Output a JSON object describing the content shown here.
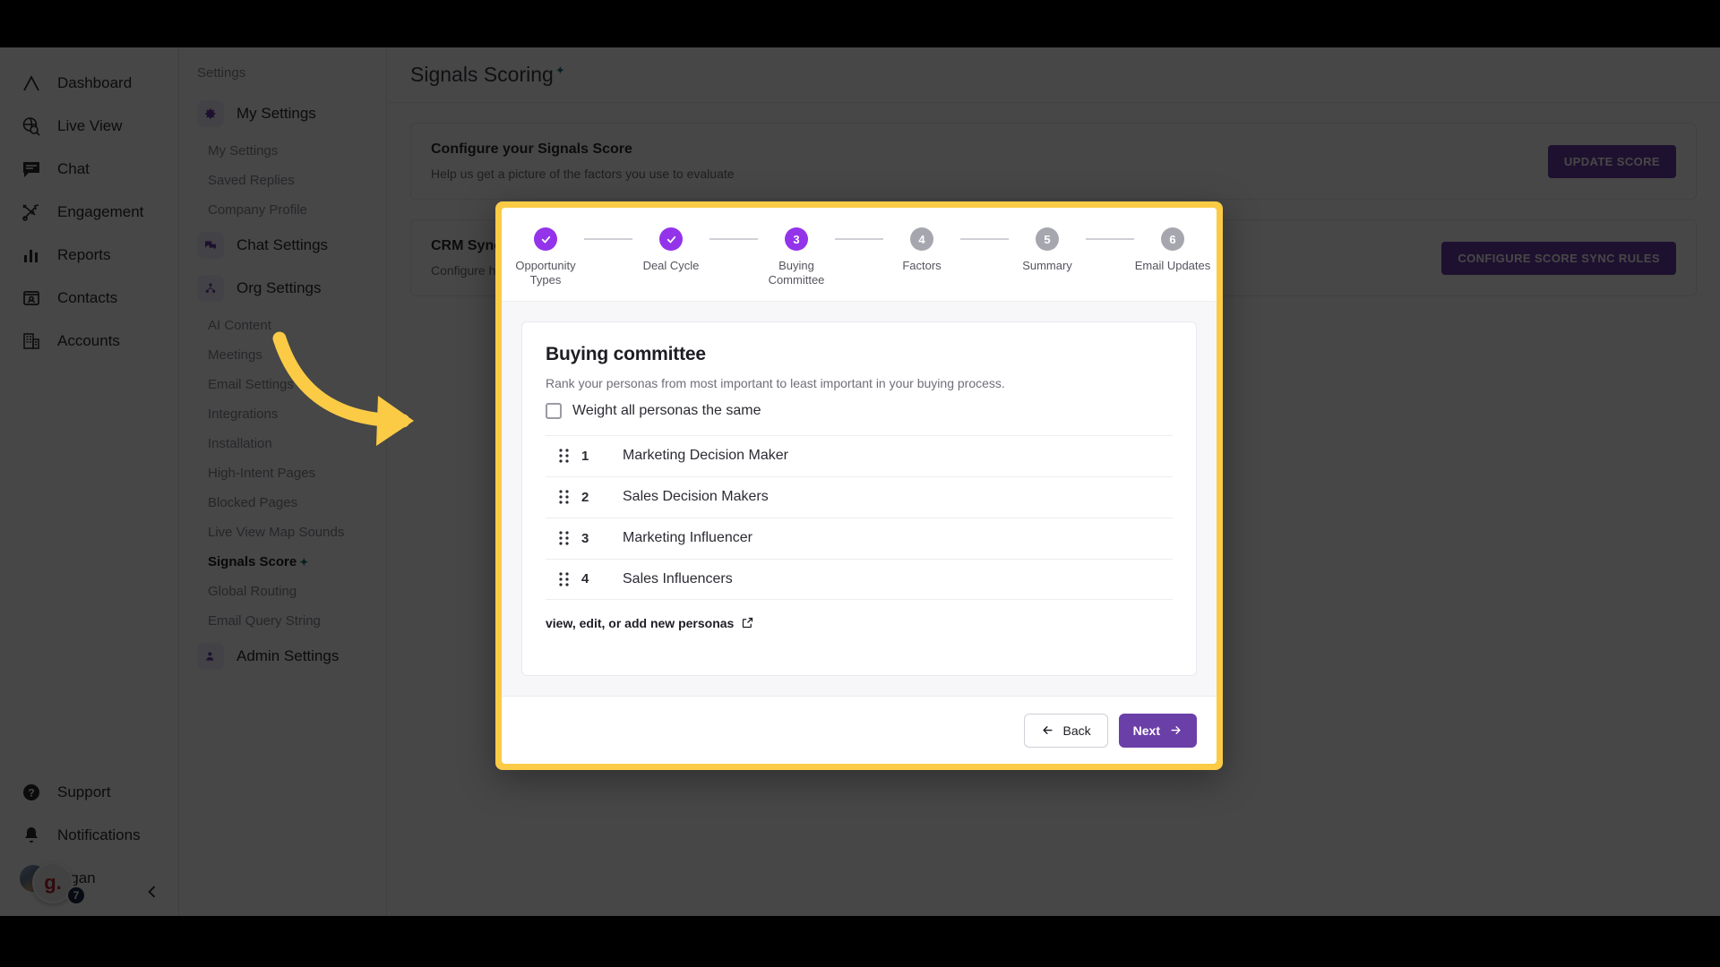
{
  "colors": {
    "highlight_yellow": "#FBCB46",
    "primary_purple": "#6B3FA8",
    "step_active_purple": "#9333EA",
    "step_inactive_gray": "#A6A6AE",
    "sparkle_teal": "#1F6F7A"
  },
  "nav": {
    "items": [
      {
        "label": "Dashboard",
        "icon": "logo-chevron-icon"
      },
      {
        "label": "Live View",
        "icon": "globe-search-icon"
      },
      {
        "label": "Chat",
        "icon": "chat-bubble-icon"
      },
      {
        "label": "Engagement",
        "icon": "engagement-play-icon"
      },
      {
        "label": "Reports",
        "icon": "bar-chart-icon"
      },
      {
        "label": "Contacts",
        "icon": "contact-card-icon"
      },
      {
        "label": "Accounts",
        "icon": "building-icon"
      }
    ],
    "bottom": [
      {
        "label": "Support",
        "icon": "help-circle-icon"
      },
      {
        "label": "Notifications",
        "icon": "bell-icon"
      }
    ],
    "user": {
      "name": "Ngan",
      "badge_letter": "g.",
      "badge_count": "7"
    }
  },
  "settings_nav": {
    "title": "Settings",
    "groups": [
      {
        "label": "My Settings",
        "icon": "gear-icon",
        "items": [
          {
            "label": "My Settings"
          },
          {
            "label": "Saved Replies"
          },
          {
            "label": "Company Profile"
          }
        ]
      },
      {
        "label": "Chat Settings",
        "icon": "chat-settings-icon",
        "items": []
      },
      {
        "label": "Org Settings",
        "icon": "org-nodes-icon",
        "items": [
          {
            "label": "AI Content"
          },
          {
            "label": "Meetings"
          },
          {
            "label": "Email Settings"
          },
          {
            "label": "Integrations"
          },
          {
            "label": "Installation"
          },
          {
            "label": "High-Intent Pages"
          },
          {
            "label": "Blocked Pages"
          },
          {
            "label": "Live View Map Sounds"
          },
          {
            "label": "Signals Score",
            "active": true,
            "sparkle": true
          },
          {
            "label": "Global Routing"
          },
          {
            "label": "Email Query String"
          }
        ]
      },
      {
        "label": "Admin Settings",
        "icon": "admin-user-icon",
        "items": []
      }
    ]
  },
  "page": {
    "title": "Signals Scoring",
    "title_sparkle": "✦",
    "cards": [
      {
        "title": "Configure your Signals Score",
        "desc": "Help us get a picture of the factors you use to evaluate",
        "button": "UPDATE SCORE"
      },
      {
        "title": "CRM Sync",
        "desc": "Configure how your scores sync",
        "button": "CONFIGURE SCORE SYNC RULES"
      }
    ]
  },
  "modal": {
    "stepper": [
      {
        "number": "1",
        "label": "Opportunity Types",
        "state": "done"
      },
      {
        "number": "2",
        "label": "Deal Cycle",
        "state": "done"
      },
      {
        "number": "3",
        "label": "Buying Committee",
        "state": "current"
      },
      {
        "number": "4",
        "label": "Factors",
        "state": "upcoming"
      },
      {
        "number": "5",
        "label": "Summary",
        "state": "upcoming"
      },
      {
        "number": "6",
        "label": "Email Updates",
        "state": "upcoming"
      }
    ],
    "panel": {
      "title": "Buying committee",
      "description": "Rank your personas from most important to least important in your buying process.",
      "checkbox_label": "Weight all personas the same",
      "checkbox_checked": false,
      "personas": [
        {
          "rank": "1",
          "name": "Marketing Decision Maker"
        },
        {
          "rank": "2",
          "name": "Sales Decision Makers"
        },
        {
          "rank": "3",
          "name": "Marketing Influencer"
        },
        {
          "rank": "4",
          "name": "Sales Influencers"
        }
      ],
      "link_label": "view, edit, or add new personas"
    },
    "footer": {
      "back_label": "Back",
      "next_label": "Next"
    }
  }
}
